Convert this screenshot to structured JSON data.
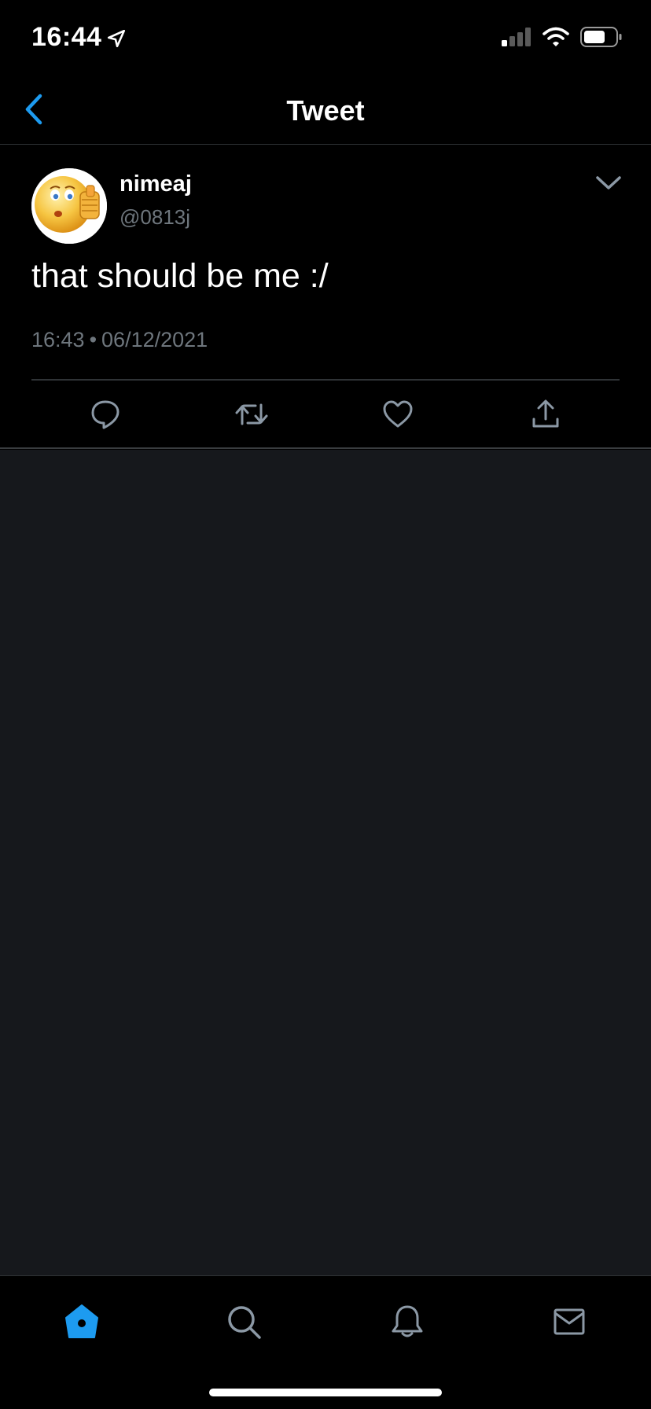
{
  "status_bar": {
    "time": "16:44",
    "icons": [
      "location-arrow-icon",
      "cellular-signal-icon",
      "wifi-icon",
      "battery-icon"
    ]
  },
  "nav": {
    "title": "Tweet",
    "back_icon": "chevron-left-icon"
  },
  "tweet": {
    "display_name": "nimeaj",
    "handle": "@0813j",
    "text": "that should be me :/",
    "time": "16:43",
    "date": "06/12/2021",
    "separator": "•",
    "avatar": "emoji-avatar",
    "menu_icon": "chevron-down-icon"
  },
  "actions": [
    "reply-icon",
    "retweet-icon",
    "like-icon",
    "share-icon"
  ],
  "tab_bar": {
    "tabs": [
      "home-icon",
      "search-icon",
      "notifications-icon",
      "messages-icon"
    ],
    "active": "home"
  },
  "colors": {
    "accent": "#1d9bf0",
    "background": "#000000",
    "empty_area": "#16181c",
    "secondary_text": "#6e767d",
    "icon_gray": "#8b98a5"
  }
}
